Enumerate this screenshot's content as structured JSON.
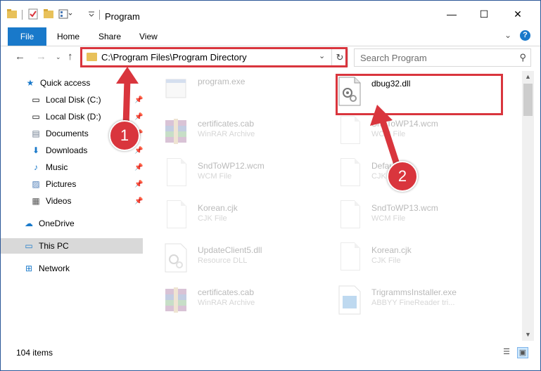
{
  "window": {
    "title": "Program",
    "minimize_glyph": "—",
    "maximize_glyph": "☐",
    "close_glyph": "✕"
  },
  "ribbon": {
    "tabs": [
      "File",
      "Home",
      "Share",
      "View"
    ],
    "help_glyph": "?",
    "collapse_glyph": "⌄"
  },
  "address": {
    "path": "C:\\Program Files\\Program Directory",
    "search_placeholder": "Search Program"
  },
  "nav_pane": {
    "quick_access": "Quick access",
    "items": [
      {
        "label": "Local Disk (C:)",
        "icon": "drive-icon",
        "pinned": true
      },
      {
        "label": "Local Disk (D:)",
        "icon": "drive-icon",
        "pinned": true
      },
      {
        "label": "Documents",
        "icon": "documents-icon",
        "pinned": true
      },
      {
        "label": "Downloads",
        "icon": "downloads-icon",
        "pinned": true
      },
      {
        "label": "Music",
        "icon": "music-icon",
        "pinned": true
      },
      {
        "label": "Pictures",
        "icon": "pictures-icon",
        "pinned": true
      },
      {
        "label": "Videos",
        "icon": "videos-icon",
        "pinned": true
      }
    ],
    "onedrive": "OneDrive",
    "this_pc": "This PC",
    "network": "Network"
  },
  "files": [
    {
      "name": "program.exe",
      "type": "",
      "icon": "exe-icon",
      "highlighted": false
    },
    {
      "name": "dbug32.dll",
      "type": "",
      "icon": "dll-icon",
      "highlighted": true
    },
    {
      "name": "certificates.cab",
      "type": "WinRAR Archive",
      "icon": "rar-icon",
      "highlighted": false
    },
    {
      "name": "SndToWP14.wcm",
      "type": "WCM File",
      "icon": "doc-icon",
      "highlighted": false
    },
    {
      "name": "SndToWP12.wcm",
      "type": "WCM File",
      "icon": "doc-icon",
      "highlighted": false
    },
    {
      "name": "Default.cjk",
      "type": "CJK File",
      "icon": "doc-icon",
      "highlighted": false
    },
    {
      "name": "Korean.cjk",
      "type": "CJK File",
      "icon": "doc-icon",
      "highlighted": false
    },
    {
      "name": "SndToWP13.wcm",
      "type": "WCM File",
      "icon": "doc-icon",
      "highlighted": false
    },
    {
      "name": "UpdateClient5.dll",
      "type": "Resource DLL",
      "icon": "dll-icon",
      "highlighted": false
    },
    {
      "name": "Korean.cjk",
      "type": "CJK File",
      "icon": "doc-icon",
      "highlighted": false
    },
    {
      "name": "certificates.cab",
      "type": "WinRAR Archive",
      "icon": "rar-icon",
      "highlighted": false
    },
    {
      "name": "TrigrammsInstaller.exe",
      "type": "ABBYY FineReader tri...",
      "icon": "exe-icon",
      "highlighted": false
    }
  ],
  "status": {
    "item_count": "104 items"
  },
  "annotations": {
    "step1": "1",
    "step2": "2",
    "color": "#d9353d"
  }
}
